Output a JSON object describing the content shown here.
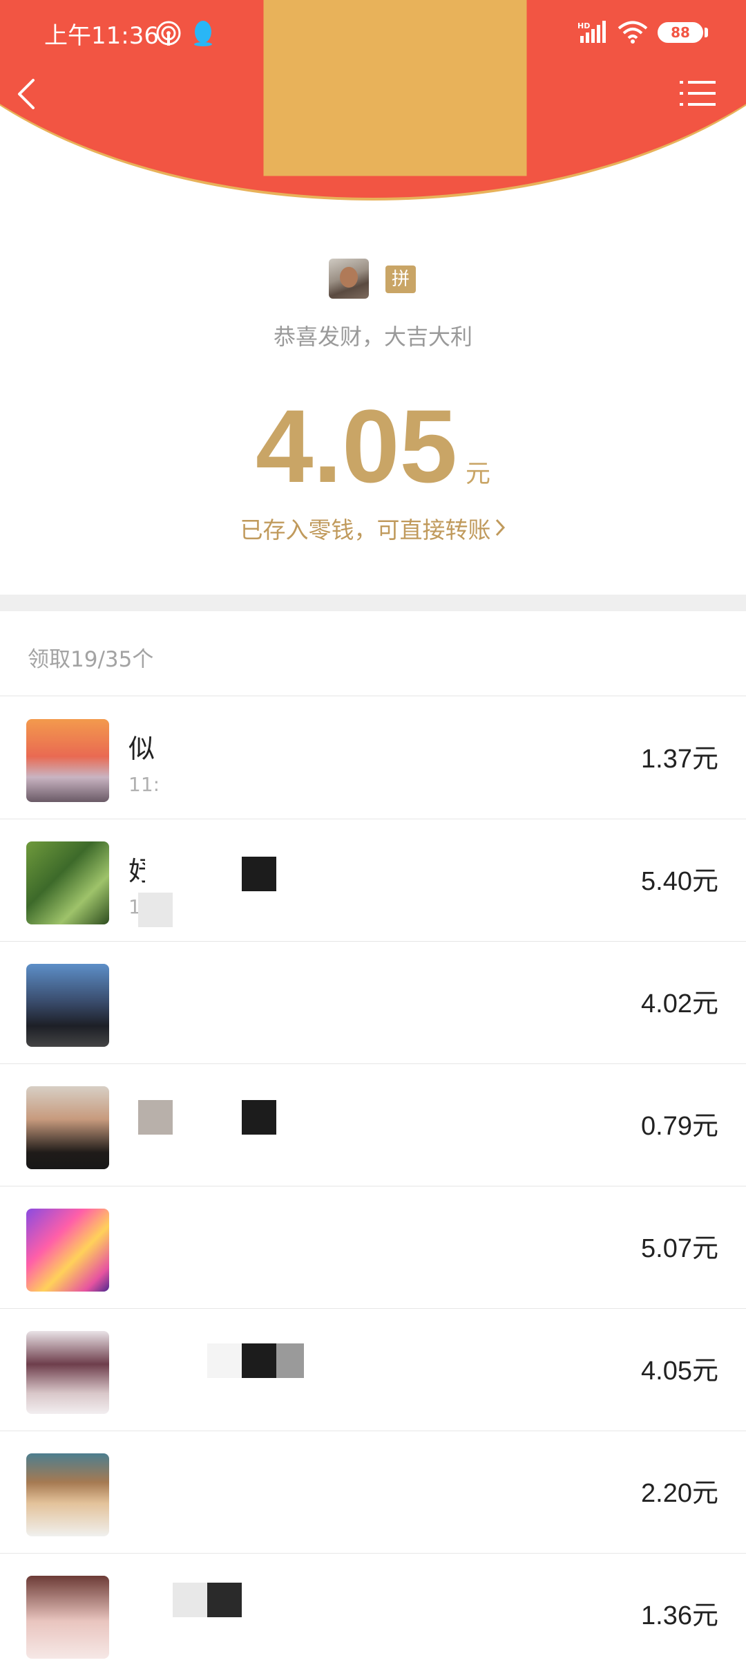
{
  "status_bar": {
    "time": "上午11:36",
    "battery": "88"
  },
  "icons": {
    "back": "chevron-left-icon",
    "menu": "list-menu-icon",
    "hotspot": "hotspot-icon",
    "qq": "qq-penguin-icon",
    "signal": "signal-hd-icon",
    "wifi": "wifi-icon"
  },
  "colors": {
    "header_red": "#f25543",
    "gold": "#c9a566",
    "gold_border": "#e8b25a"
  },
  "sender": {
    "badge": "拼",
    "blessing": "恭喜发财，大吉大利"
  },
  "received": {
    "amount": "4.05",
    "unit": "元",
    "wallet_link": "已存入零钱，可直接转账"
  },
  "claimed": "领取19/35个",
  "list": [
    {
      "name": "似",
      "time": "11:",
      "amount": "1.37元"
    },
    {
      "name": "妤",
      "time": "1",
      "amount": "5.40元"
    },
    {
      "name": "",
      "time": "",
      "amount": "4.02元"
    },
    {
      "name": "",
      "time": "",
      "amount": "0.79元"
    },
    {
      "name": "",
      "time": "",
      "amount": "5.07元"
    },
    {
      "name": "",
      "time": "",
      "amount": "4.05元"
    },
    {
      "name": "",
      "time": "",
      "amount": "2.20元"
    },
    {
      "name": "",
      "time": "",
      "amount": "1.36元"
    }
  ]
}
